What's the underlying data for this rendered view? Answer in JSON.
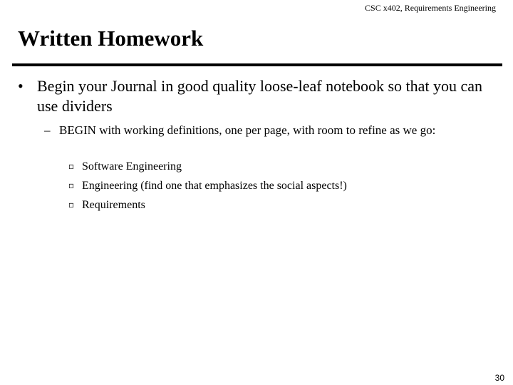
{
  "header": {
    "course": "CSC x402, Requirements  Engineering"
  },
  "slide": {
    "title": "Written Homework",
    "bullets": [
      {
        "marker": "•",
        "text": "Begin your Journal in good quality loose-leaf notebook so that you can use dividers",
        "sub_bullets": [
          {
            "marker": "–",
            "text": "BEGIN with working definitions, one per page, with room to refine as we go:",
            "items": [
              {
                "marker": "¤",
                "text": "Software Engineering"
              },
              {
                "marker": "¤",
                "text": "Engineering (find one that emphasizes the social aspects!)"
              },
              {
                "marker": "¤",
                "text": "Requirements"
              }
            ]
          }
        ]
      }
    ]
  },
  "footer": {
    "page_number": "30"
  }
}
